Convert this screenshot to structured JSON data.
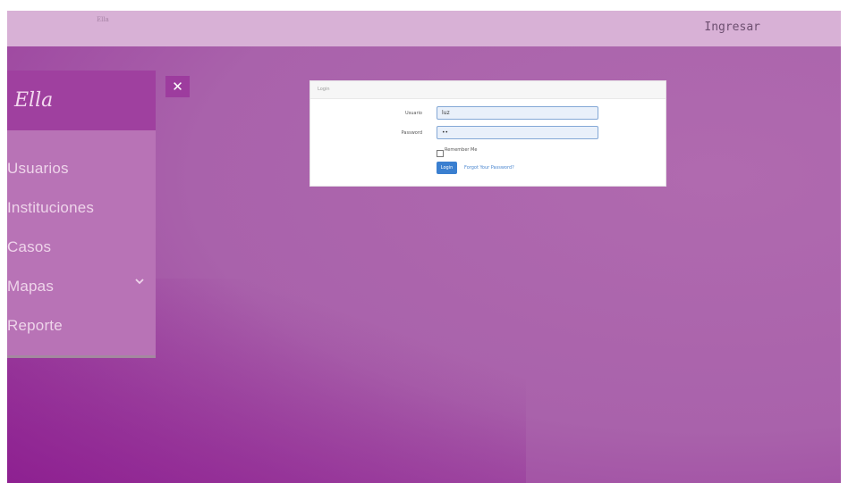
{
  "topbar": {
    "brand_mini": "Ella",
    "login_link": "Ingresar"
  },
  "sidebar": {
    "logo": "Ella",
    "items": [
      {
        "label": "Usuarios"
      },
      {
        "label": "Instituciones"
      },
      {
        "label": "Casos"
      },
      {
        "label": "Mapas",
        "icon": "chevron-down-icon"
      },
      {
        "label": "Reporte"
      }
    ]
  },
  "close_button": {
    "icon": "close-icon",
    "glyph": "✕"
  },
  "login_panel": {
    "heading": "Login",
    "username_label": "Usuario",
    "username_value": "luz",
    "password_label": "Password",
    "password_value": "••",
    "remember_label": "Remember Me",
    "login_button": "Login",
    "forgot_link": "Forgot Your Password?"
  },
  "colors": {
    "topbar": "#d8b1d6",
    "sidebar": "#b873b6",
    "logo_block": "#9f409f",
    "accent_button": "#3a7fd0"
  }
}
